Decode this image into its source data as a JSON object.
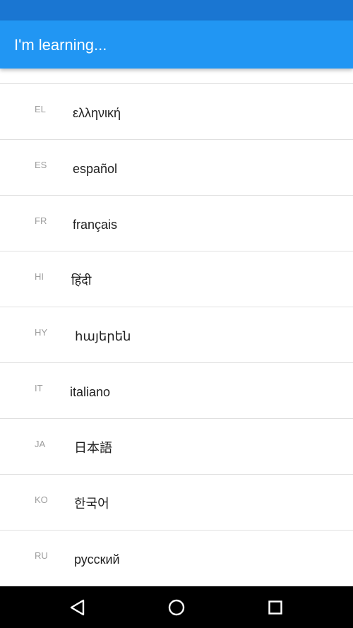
{
  "app_bar": {
    "title": "I'm learning..."
  },
  "languages": [
    {
      "code": "EL",
      "name": "ελληνική"
    },
    {
      "code": "ES",
      "name": "español"
    },
    {
      "code": "FR",
      "name": "français"
    },
    {
      "code": "HI",
      "name": "हिंदी"
    },
    {
      "code": "HY",
      "name": "հայերեն"
    },
    {
      "code": "IT",
      "name": "italiano"
    },
    {
      "code": "JA",
      "name": "日本語"
    },
    {
      "code": "KO",
      "name": "한국어"
    },
    {
      "code": "RU",
      "name": "русский"
    }
  ],
  "navigation": {
    "back": "back-icon",
    "home": "home-icon",
    "recents": "recents-icon"
  },
  "colors": {
    "status_bar": "#1a76d2",
    "app_bar": "#2196f3",
    "nav_bar": "#000000",
    "code_text": "#9e9e9e",
    "name_text": "#212121"
  }
}
